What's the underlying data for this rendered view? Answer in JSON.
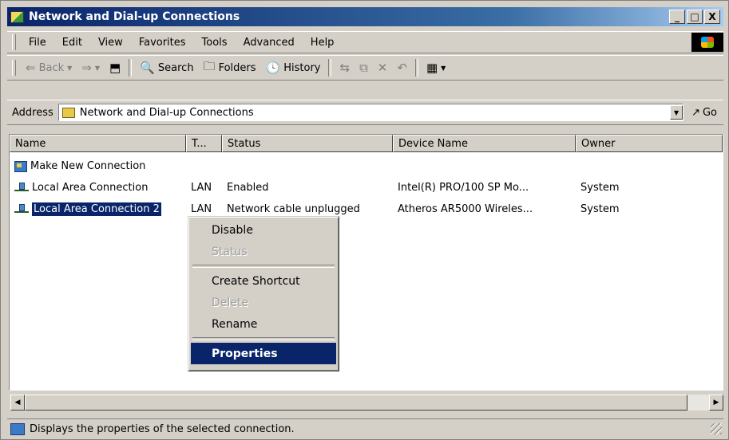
{
  "window": {
    "title": "Network and Dial-up Connections",
    "minimize": "_",
    "maximize": "□",
    "close": "X"
  },
  "menu": [
    "File",
    "Edit",
    "View",
    "Favorites",
    "Tools",
    "Advanced",
    "Help"
  ],
  "toolbar": {
    "back": "Back",
    "search": "Search",
    "folders": "Folders",
    "history": "History"
  },
  "address": {
    "label": "Address",
    "value": "Network and Dial-up Connections",
    "go": "Go"
  },
  "list": {
    "columns": [
      "Name",
      "T...",
      "Status",
      "Device Name",
      "Owner"
    ],
    "rows": [
      {
        "name": "Make New Connection",
        "type": "",
        "status": "",
        "device": "",
        "owner": "",
        "icon": "new-connection-icon"
      },
      {
        "name": "Local Area Connection",
        "type": "LAN",
        "status": "Enabled",
        "device": "Intel(R) PRO/100 SP Mo...",
        "owner": "System",
        "icon": "lan-connection-icon"
      },
      {
        "name": "Local Area Connection 2",
        "type": "LAN",
        "status": "Network cable unplugged",
        "device": "Atheros AR5000 Wireles...",
        "owner": "System",
        "icon": "lan-connection-icon",
        "selected": true
      }
    ]
  },
  "context_menu": {
    "items": [
      {
        "label": "Disable",
        "disabled": false
      },
      {
        "label": "Status",
        "disabled": true
      },
      {
        "label": "Create Shortcut",
        "disabled": false
      },
      {
        "label": "Delete",
        "disabled": true
      },
      {
        "label": "Rename",
        "disabled": false
      },
      {
        "label": "Properties",
        "disabled": false,
        "default": true,
        "highlighted": true
      }
    ]
  },
  "status_bar": {
    "text": "Displays the properties of the selected connection."
  }
}
